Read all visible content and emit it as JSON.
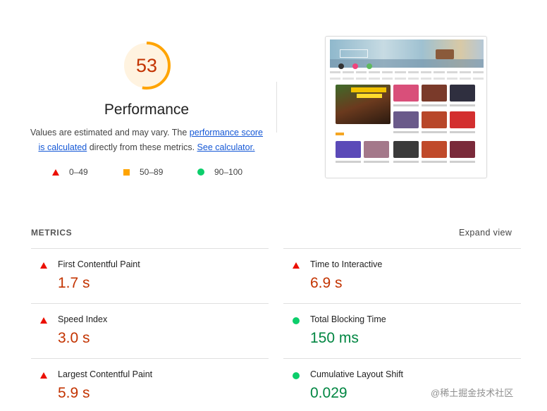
{
  "score": {
    "value": "53",
    "fraction": 0.53,
    "color": "#ffa400",
    "track_color": "#fff3e0"
  },
  "title": "Performance",
  "description": {
    "part1": "Values are estimated and may vary. The ",
    "link1": "performance score is calculated",
    "part2": " directly from these metrics. ",
    "link2": "See calculator."
  },
  "legend": [
    {
      "range": "0–49",
      "icon": "triangle-fail-icon",
      "color": "#eb0f00"
    },
    {
      "range": "50–89",
      "icon": "square-average-icon",
      "color": "#ffa400"
    },
    {
      "range": "90–100",
      "icon": "circle-pass-icon",
      "color": "#0cce6b"
    }
  ],
  "metrics_header": {
    "title": "METRICS",
    "expand": "Expand view"
  },
  "metrics": [
    {
      "name": "First Contentful Paint",
      "value": "1.7 s",
      "status": "fail"
    },
    {
      "name": "Time to Interactive",
      "value": "6.9 s",
      "status": "fail"
    },
    {
      "name": "Speed Index",
      "value": "3.0 s",
      "status": "fail"
    },
    {
      "name": "Total Blocking Time",
      "value": "150 ms",
      "status": "pass"
    },
    {
      "name": "Largest Contentful Paint",
      "value": "5.9 s",
      "status": "fail"
    },
    {
      "name": "Cumulative Layout Shift",
      "value": "0.029",
      "status": "pass"
    }
  ],
  "watermark": "@稀土掘金技术社区"
}
